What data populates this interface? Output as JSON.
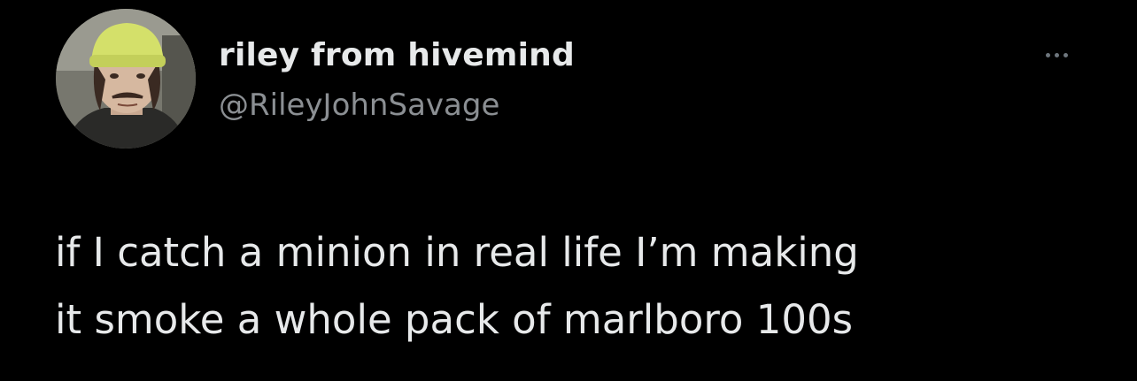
{
  "tweet": {
    "author": {
      "display_name": "riley from hivemind",
      "handle": "@RileyJohnSavage",
      "avatar": "profile-photo"
    },
    "more_icon": "ellipsis-icon",
    "text_lines": [
      "if I catch a minion in real life I’m making",
      "it smoke a whole pack of marlboro 100s"
    ]
  },
  "colors": {
    "background": "#000000",
    "primary_text": "#e7e9ea",
    "secondary_text": "#8b8f93",
    "icon": "#6e767d"
  }
}
